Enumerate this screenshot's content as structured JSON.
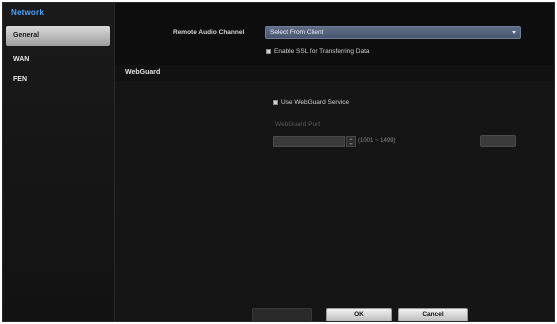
{
  "sidebar": {
    "title": "Network",
    "items": [
      {
        "label": "General",
        "active": true
      },
      {
        "label": "WAN",
        "active": false
      },
      {
        "label": "FEN",
        "active": false
      }
    ]
  },
  "general": {
    "remote_audio_label": "Remote Audio Channel",
    "remote_audio_value": "Select From Client",
    "ssl_label": "Enable SSL for Transferring Data",
    "ssl_checked": true
  },
  "webguard": {
    "section_title": "WebGuard",
    "use_service_label": "Use WebGuard Service",
    "use_service_checked": true,
    "port_label": "WebGuard Port",
    "port_value": "",
    "port_range": "(1001 ~ 1499)"
  },
  "buttons": {
    "apply": "",
    "ok": "OK",
    "cancel": "Cancel"
  },
  "colors": {
    "accent": "#4aa3ff",
    "select_bg": "#5f6d86",
    "window_bg": "#101010"
  }
}
